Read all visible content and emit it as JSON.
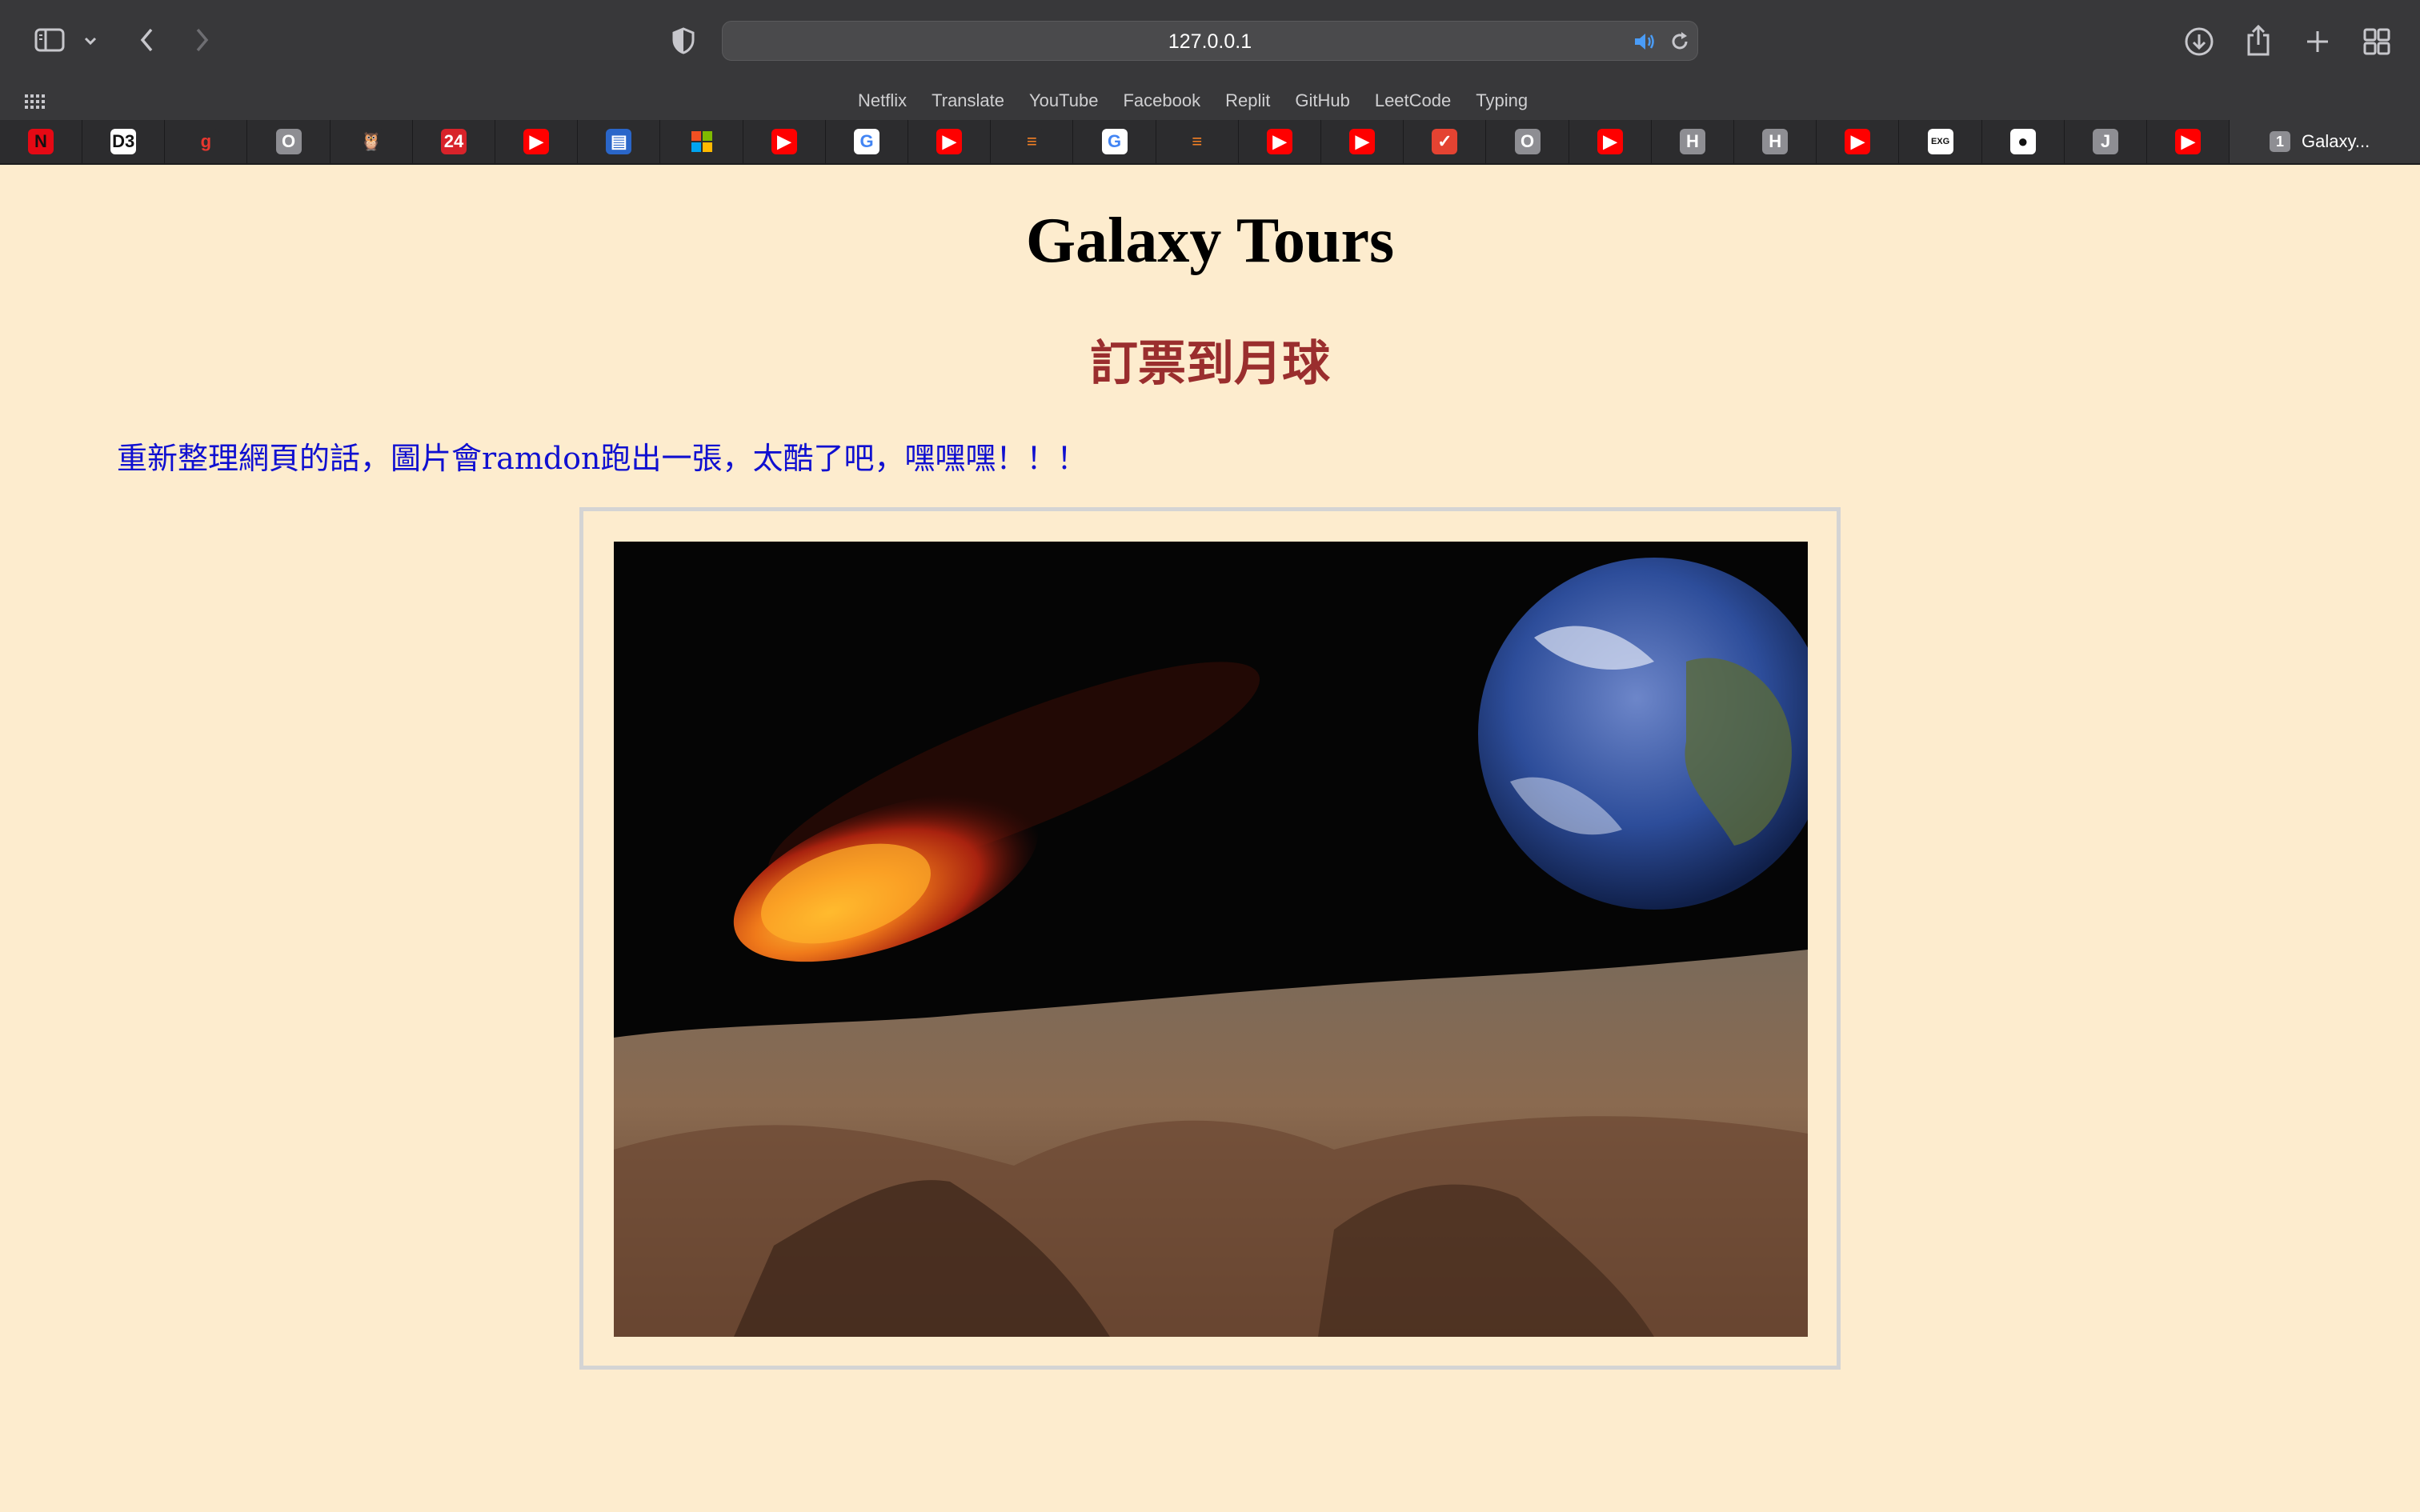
{
  "browser": {
    "address": "127.0.0.1",
    "bookmarks": [
      "Netflix",
      "Translate",
      "YouTube",
      "Facebook",
      "Replit",
      "GitHub",
      "LeetCode",
      "Typing"
    ],
    "pinned_tabs": [
      {
        "icon": "netflix-icon",
        "glyph": "N",
        "color": "#e50914",
        "fg": "#111111"
      },
      {
        "icon": "d3-icon",
        "glyph": "D3",
        "color": "#ffffff",
        "fg": "#111111"
      },
      {
        "icon": "g-logo-icon",
        "glyph": "g",
        "color": "#2c2c2e",
        "fg": "#e8372f"
      },
      {
        "icon": "letter-o-icon",
        "glyph": "O",
        "color": "#8e8e93",
        "fg": "#ffffff"
      },
      {
        "icon": "owl-icon",
        "glyph": "🦉",
        "color": "#2c2c2e",
        "fg": "#ffffff"
      },
      {
        "icon": "24-icon",
        "glyph": "24",
        "color": "#d8232a",
        "fg": "#ffffff"
      },
      {
        "icon": "youtube-icon",
        "glyph": "▶",
        "color": "#ff0000",
        "fg": "#ffffff"
      },
      {
        "icon": "app-blue-icon",
        "glyph": "▤",
        "color": "#2a66c9",
        "fg": "#ffffff"
      },
      {
        "icon": "microsoft-icon",
        "glyph": "",
        "color": "#2c2c2e",
        "fg": "#ffffff"
      },
      {
        "icon": "youtube-icon",
        "glyph": "▶",
        "color": "#ff0000",
        "fg": "#ffffff"
      },
      {
        "icon": "google-icon",
        "glyph": "G",
        "color": "#ffffff",
        "fg": "#4285f4"
      },
      {
        "icon": "youtube-icon",
        "glyph": "▶",
        "color": "#ff0000",
        "fg": "#ffffff"
      },
      {
        "icon": "stackoverflow-icon",
        "glyph": "≡",
        "color": "#2c2c2e",
        "fg": "#f48024"
      },
      {
        "icon": "google-icon",
        "glyph": "G",
        "color": "#ffffff",
        "fg": "#4285f4"
      },
      {
        "icon": "stackoverflow-icon",
        "glyph": "≡",
        "color": "#2c2c2e",
        "fg": "#f48024"
      },
      {
        "icon": "youtube-icon",
        "glyph": "▶",
        "color": "#ff0000",
        "fg": "#ffffff"
      },
      {
        "icon": "youtube-icon",
        "glyph": "▶",
        "color": "#ff0000",
        "fg": "#ffffff"
      },
      {
        "icon": "todoist-icon",
        "glyph": "✓",
        "color": "#e44332",
        "fg": "#ffffff"
      },
      {
        "icon": "letter-o-icon",
        "glyph": "O",
        "color": "#8e8e93",
        "fg": "#ffffff"
      },
      {
        "icon": "youtube-icon",
        "glyph": "▶",
        "color": "#ff0000",
        "fg": "#ffffff"
      },
      {
        "icon": "letter-h-icon",
        "glyph": "H",
        "color": "#8e8e93",
        "fg": "#ffffff"
      },
      {
        "icon": "letter-h-icon",
        "glyph": "H",
        "color": "#8e8e93",
        "fg": "#ffffff"
      },
      {
        "icon": "youtube-icon",
        "glyph": "▶",
        "color": "#ff0000",
        "fg": "#ffffff"
      },
      {
        "icon": "exg-icon",
        "glyph": "EXG",
        "color": "#ffffff",
        "fg": "#111111"
      },
      {
        "icon": "github-icon",
        "glyph": "●",
        "color": "#ffffff",
        "fg": "#111111"
      },
      {
        "icon": "letter-j-icon",
        "glyph": "J",
        "color": "#8e8e93",
        "fg": "#ffffff"
      },
      {
        "icon": "youtube-icon",
        "glyph": "▶",
        "color": "#ff0000",
        "fg": "#ffffff"
      }
    ],
    "active_tab": {
      "badge": "1",
      "title": "Galaxy..."
    }
  },
  "page": {
    "title": "Galaxy Tours",
    "subtitle": "訂票到月球",
    "note": "重新整理網頁的話，圖片會ramdon跑出一張，太酷了吧，嘿嘿嘿！！！"
  },
  "colors": {
    "page_background": "#fdecce",
    "subtitle": "#9a2e2e",
    "note": "#1010d0",
    "chrome": "#38383a"
  }
}
